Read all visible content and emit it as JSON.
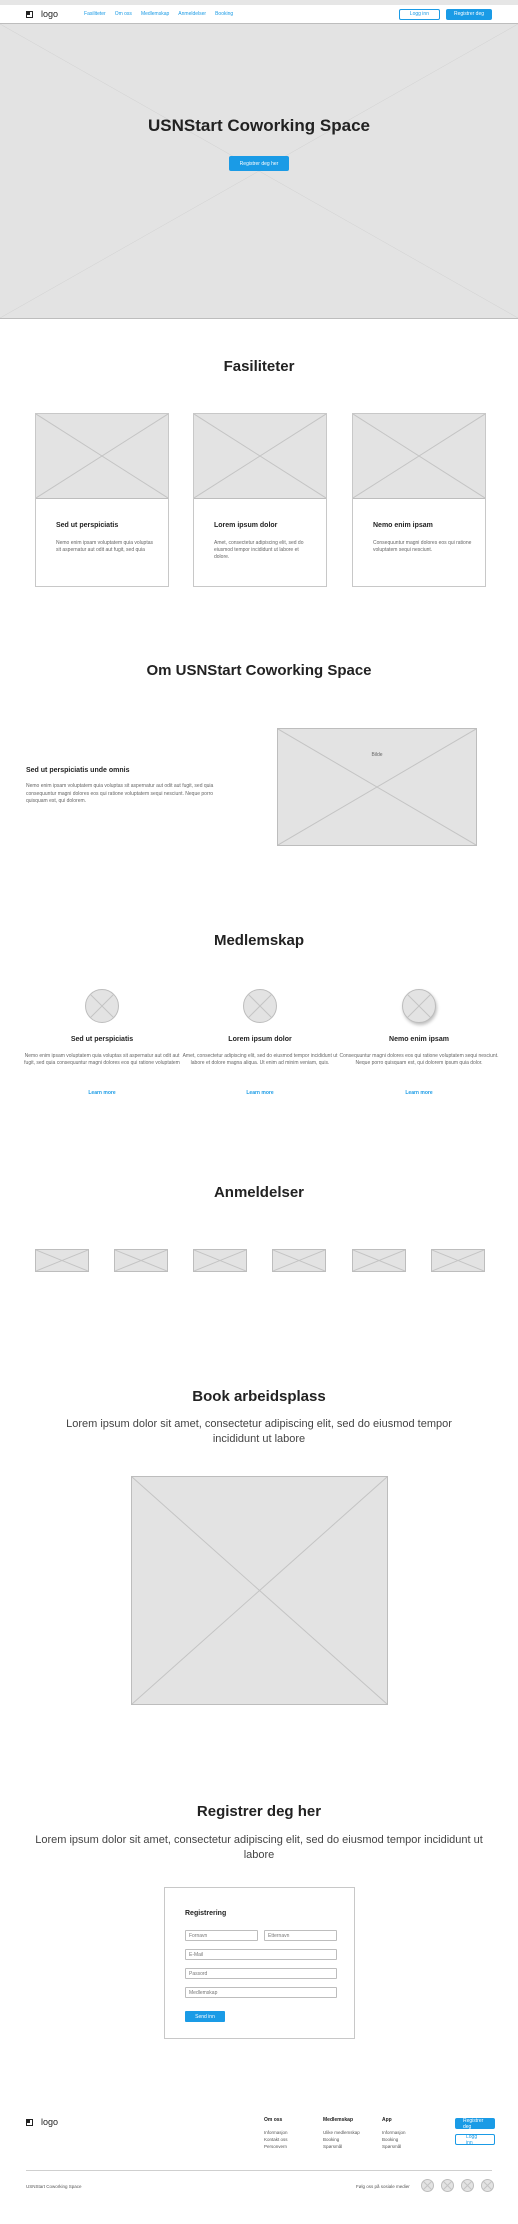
{
  "header": {
    "logo": "logo",
    "nav": [
      "Fasiliteter",
      "Om oss",
      "Medlemskap",
      "Anmeldelser",
      "Booking"
    ],
    "login": "Logg inn",
    "register": "Registrer deg"
  },
  "hero": {
    "title": "USNStart Coworking Space",
    "button": "Registrer deg her"
  },
  "facilities": {
    "title": "Fasiliteter",
    "cards": [
      {
        "title": "Sed ut perspiciatis",
        "text": "Nemo enim ipsam voluptatem quia voluptas sit aspernatur aut odit aut fugit, sed quia"
      },
      {
        "title": "Lorem ipsum dolor",
        "text": "Amet, consectetur adipiscing elit, sed do eiusmod tempor incididunt ut labore et dolore."
      },
      {
        "title": "Nemo enim ipsam",
        "text": "Consequuntur magni dolores eos qui ratione voluptatem sequi nesciunt."
      }
    ]
  },
  "about": {
    "title": "Om USNStart Coworking Space",
    "heading": "Sed ut perspiciatis unde omnis",
    "text": "Nemo enim ipsam voluptatem quia voluptas sit aspernatur aut odit aut fugit, sed quia consequuntur magni dolores eos qui ratione voluptatem sequi nesciunt. Neque porro quisquam est, qui dolorem.",
    "image_label": "Bilde"
  },
  "membership": {
    "title": "Medlemskap",
    "items": [
      {
        "title": "Sed ut perspiciatis",
        "text": "Nemo enim ipsam voluptatem quia voluptas sit aspernatur aut odit aut fugit, sed quia consequuntur magni dolores eos qui ratione voluptatem",
        "link": "Learn more"
      },
      {
        "title": "Lorem ipsum dolor",
        "text": "Amet, consectetur adipiscing elit, sed do eiusmod tempor incididunt ut labore et dolore magna aliqua. Ut enim ad minim veniam, quis.",
        "link": "Learn more"
      },
      {
        "title": "Nemo enim ipsam",
        "text": "Consequuntur magni dolores eos qui ratione voluptatem sequi nesciunt. Neque porro quisquam est, qui dolorem ipsum quia dolor.",
        "link": "Learn more"
      }
    ]
  },
  "reviews": {
    "title": "Anmeldelser"
  },
  "booking": {
    "title": "Book arbeidsplass",
    "subtitle": "Lorem ipsum dolor sit amet, consectetur adipiscing elit, sed do eiusmod tempor incididunt ut labore"
  },
  "register": {
    "title": "Registrer deg her",
    "subtitle": "Lorem ipsum dolor sit amet, consectetur adipiscing elit, sed do eiusmod tempor incididunt ut labore",
    "form_title": "Registrering",
    "fields": {
      "first_name": "Fornavn",
      "last_name": "Etternavn",
      "email": "E-Mail",
      "password": "Passord",
      "membership": "Medlemskap"
    },
    "submit": "Send inn"
  },
  "footer": {
    "logo": "logo",
    "columns": [
      {
        "title": "Om oss",
        "items": [
          "Informasjon",
          "Kontakt oss",
          "Personvern"
        ]
      },
      {
        "title": "Medlemskap",
        "items": [
          "Ulike medlemskap",
          "Booking",
          "Spørsmål"
        ]
      },
      {
        "title": "App",
        "items": [
          "Informasjon",
          "Booking",
          "Spørsmål"
        ]
      }
    ],
    "register": "Registrer deg",
    "login": "Logg inn",
    "copyright": "USNStart Coworking Space",
    "follow": "Følg oss på sosiale medier"
  }
}
